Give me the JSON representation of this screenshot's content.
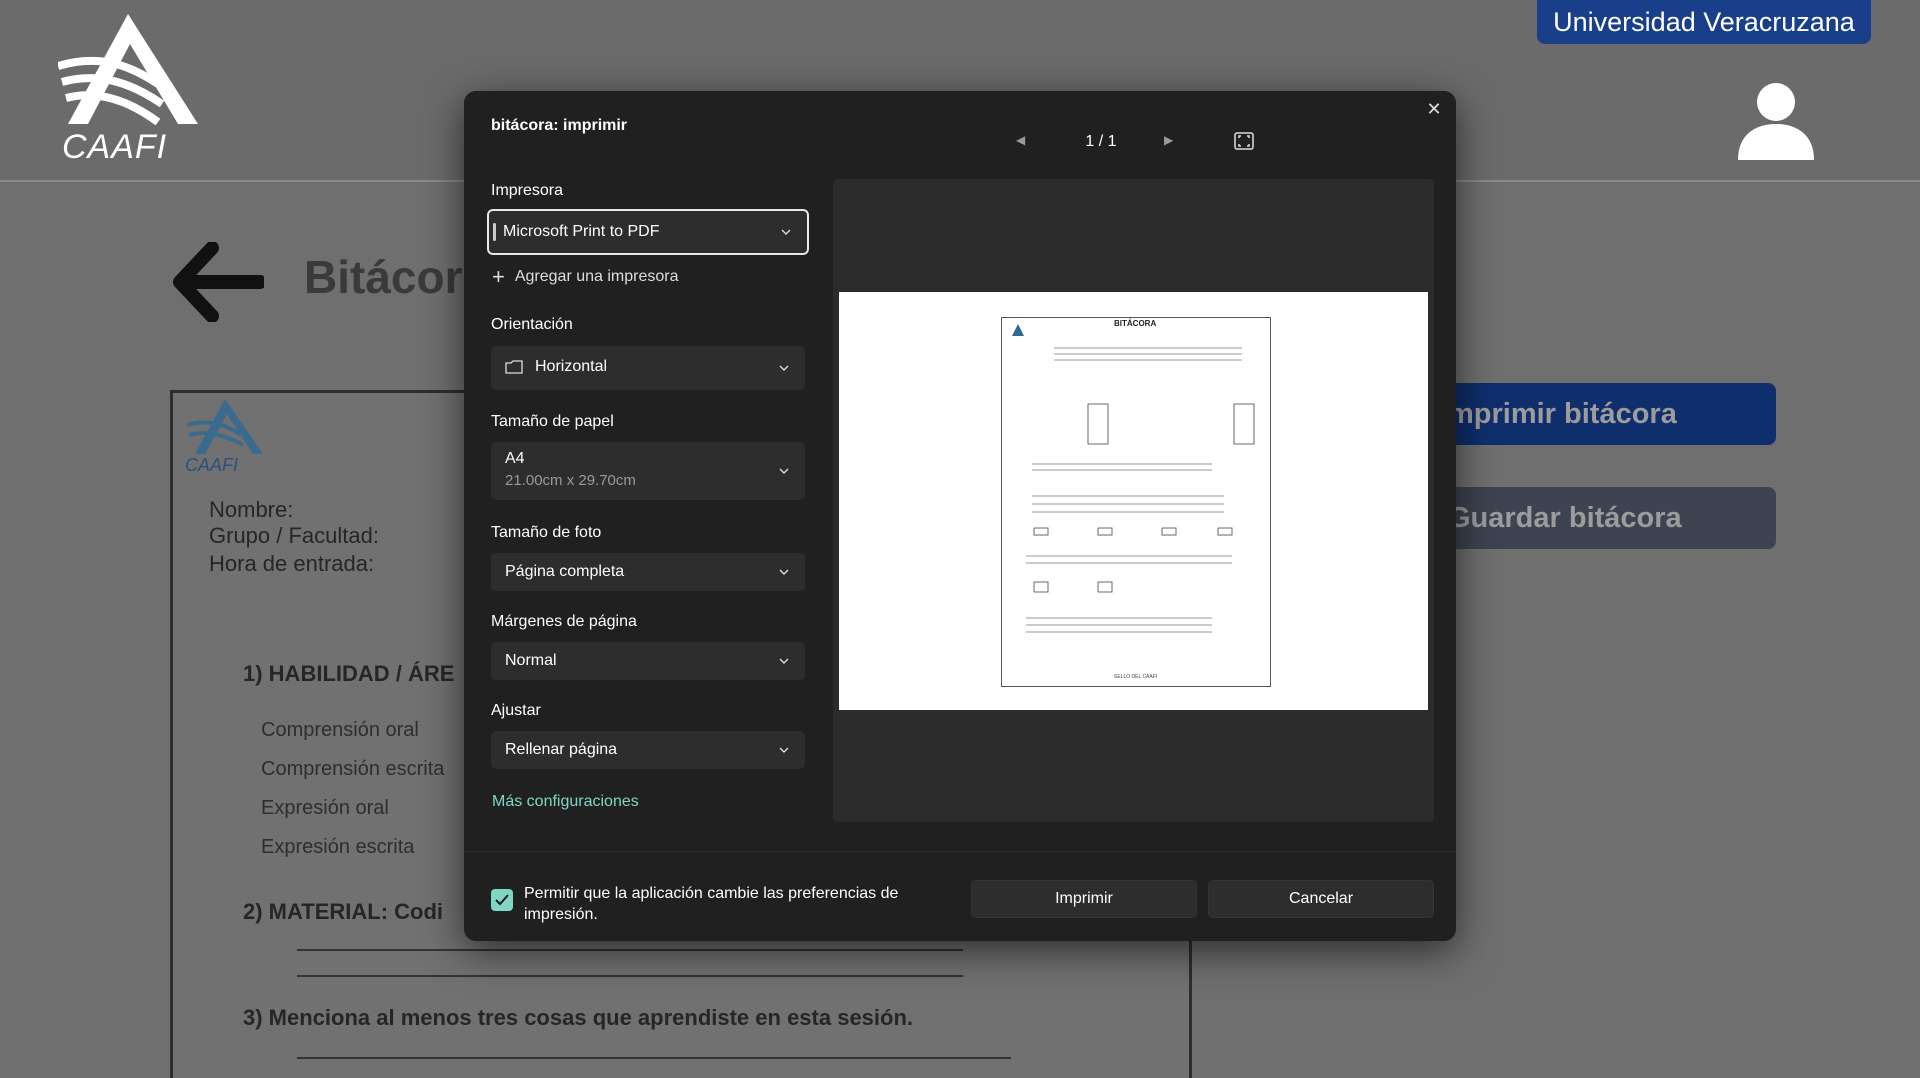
{
  "header": {
    "logo_text": "CAAFI",
    "university_badge": "Universidad Veracruzana"
  },
  "page": {
    "title": "Bitácora",
    "print_button": "Imprimir bitácora",
    "save_button": "Guardar bitácora",
    "visible_print_button": "mprimir bitácora",
    "visible_save_button": "Guardar bitácora"
  },
  "document": {
    "logo_text": "CAAFI",
    "fields": [
      "Nombre:",
      "Grupo / Facultad:",
      "Hora de entrada:"
    ],
    "section1": "1)  HABILIDAD / ÁRE",
    "skills": [
      "Comprensión oral",
      "Comprensión escrita",
      "Expresión oral",
      "Expresión escrita"
    ],
    "section2": "2)  MATERIAL: Codi",
    "section3": "3)  Menciona al menos tres cosas que aprendiste en esta sesión."
  },
  "dialog": {
    "title": "bitácora: imprimir",
    "page_indicator": "1 / 1",
    "printer": {
      "label": "Impresora",
      "value": "Microsoft Print to PDF",
      "add_printer": "Agregar una impresora"
    },
    "orientation": {
      "label": "Orientación",
      "value": "Horizontal"
    },
    "paper_size": {
      "label": "Tamaño de papel",
      "value": "A4",
      "detail": "21.00cm x 29.70cm"
    },
    "photo_size": {
      "label": "Tamaño de foto",
      "value": "Página completa"
    },
    "margins": {
      "label": "Márgenes de página",
      "value": "Normal"
    },
    "fit": {
      "label": "Ajustar",
      "value": "Rellenar página"
    },
    "more_settings": "Más configuraciones",
    "allow_prefs": "Permitir que la aplicación cambie las preferencias de impresión.",
    "allow_prefs_checked": true,
    "print_button": "Imprimir",
    "cancel_button": "Cancelar"
  },
  "preview": {
    "title": "BITÁCORA",
    "seal": "SELLO DEL CAAFI"
  },
  "colors": {
    "accent_teal": "#7fd6c4",
    "uv_blue": "#1a3f8a",
    "dialog_bg": "#202020"
  },
  "icons": [
    "caafi-logo-icon",
    "user-icon",
    "back-arrow-icon",
    "close-icon",
    "chevron-down-icon",
    "prev-page-icon",
    "next-page-icon",
    "fit-page-icon",
    "plus-icon",
    "orientation-icon",
    "check-icon"
  ]
}
